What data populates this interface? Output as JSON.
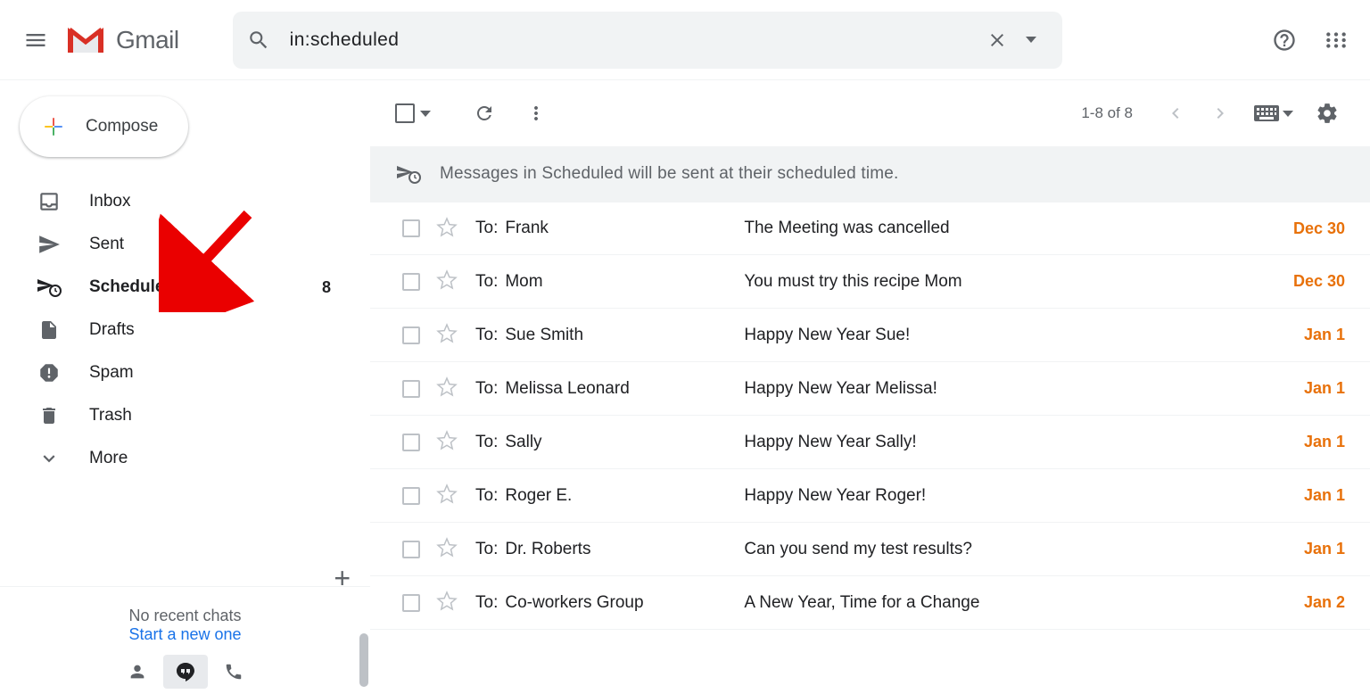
{
  "header": {
    "logo_text": "Gmail",
    "search_value": "in:scheduled"
  },
  "compose_label": "Compose",
  "sidebar": {
    "items": [
      {
        "label": "Inbox",
        "icon": "inbox",
        "count": "",
        "active": false
      },
      {
        "label": "Sent",
        "icon": "sent",
        "count": "",
        "active": false
      },
      {
        "label": "Scheduled",
        "icon": "scheduled",
        "count": "8",
        "active": true
      },
      {
        "label": "Drafts",
        "icon": "drafts",
        "count": "",
        "active": false
      },
      {
        "label": "Spam",
        "icon": "spam",
        "count": "",
        "active": false
      },
      {
        "label": "Trash",
        "icon": "trash",
        "count": "",
        "active": false
      },
      {
        "label": "More",
        "icon": "more",
        "count": "",
        "active": false
      }
    ]
  },
  "chat": {
    "no_chats": "No recent chats",
    "start_new": "Start a new one"
  },
  "toolbar": {
    "page_count": "1-8 of 8"
  },
  "banner_text": "Messages in Scheduled will be sent at their scheduled time.",
  "to_label": "To:",
  "emails": [
    {
      "recipient": "Frank",
      "subject": "The Meeting was cancelled",
      "date": "Dec 30"
    },
    {
      "recipient": "Mom",
      "subject": "You must try this recipe Mom",
      "date": "Dec 30"
    },
    {
      "recipient": "Sue Smith",
      "subject": "Happy New Year Sue!",
      "date": "Jan 1"
    },
    {
      "recipient": "Melissa Leonard",
      "subject": "Happy New Year Melissa!",
      "date": "Jan 1"
    },
    {
      "recipient": "Sally",
      "subject": "Happy New Year Sally!",
      "date": "Jan 1"
    },
    {
      "recipient": "Roger E.",
      "subject": "Happy New Year Roger!",
      "date": "Jan 1"
    },
    {
      "recipient": "Dr. Roberts",
      "subject": "Can you send my test results?",
      "date": "Jan 1"
    },
    {
      "recipient": "Co-workers Group",
      "subject": "A New Year, Time for a Change",
      "date": "Jan 2"
    }
  ]
}
